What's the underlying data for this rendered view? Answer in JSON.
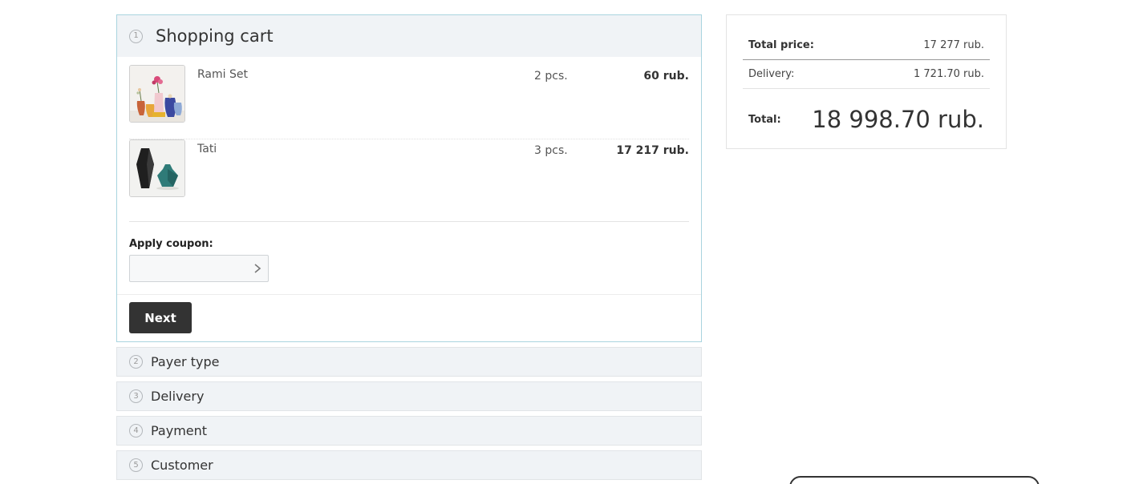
{
  "checkout": {
    "open_step": {
      "number": "1",
      "title": "Shopping cart"
    },
    "items": [
      {
        "name": "Rami Set",
        "qty": "2 pcs.",
        "price": "60 rub."
      },
      {
        "name": "Tati",
        "qty": "3 pcs.",
        "price": "17 217 rub."
      }
    ],
    "coupon": {
      "label": "Apply coupon:",
      "value": "",
      "placeholder": ""
    },
    "next_label": "Next",
    "steps": [
      {
        "number": "2",
        "title": "Payer type"
      },
      {
        "number": "3",
        "title": "Delivery"
      },
      {
        "number": "4",
        "title": "Payment"
      },
      {
        "number": "5",
        "title": "Customer"
      }
    ]
  },
  "summary": {
    "total_price_label": "Total price:",
    "total_price_value": "17 277 rub.",
    "delivery_label": "Delivery:",
    "delivery_value": "1 721.70 rub.",
    "total_label": "Total:",
    "total_value": "18 998.70 rub."
  },
  "icons": {
    "coupon_apply": "chevron-right-icon",
    "item1_image": "vase-set-image",
    "item2_image": "vase-pair-image"
  },
  "colors": {
    "accent_border": "#a9d4df",
    "step_background": "#f0f3f6",
    "button": "#333333"
  }
}
